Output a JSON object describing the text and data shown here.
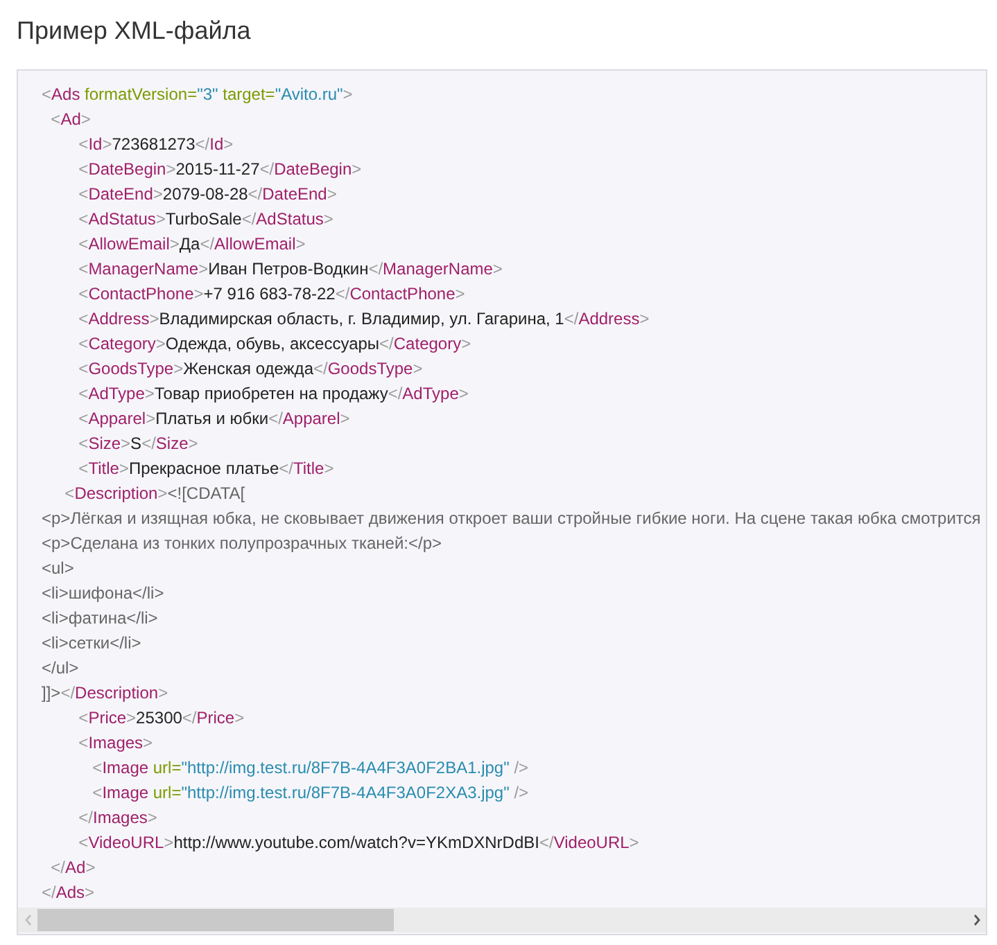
{
  "heading": "Пример XML-файла",
  "code_lines": [
    {
      "tokens": [
        {
          "kind": "punct",
          "text": "<"
        },
        {
          "kind": "tag",
          "text": "Ads"
        },
        {
          "kind": "attr",
          "text": " formatVersion="
        },
        {
          "kind": "value",
          "text": "\"3\""
        },
        {
          "kind": "attr",
          "text": " target="
        },
        {
          "kind": "value",
          "text": "\"Avito.ru\""
        },
        {
          "kind": "punct",
          "text": ">"
        }
      ]
    },
    {
      "tokens": [
        {
          "kind": "punct",
          "text": "  <"
        },
        {
          "kind": "tag",
          "text": "Ad"
        },
        {
          "kind": "punct",
          "text": ">"
        }
      ]
    },
    {
      "tokens": [
        {
          "kind": "punct",
          "text": "        <"
        },
        {
          "kind": "tag",
          "text": "Id"
        },
        {
          "kind": "punct",
          "text": ">"
        },
        {
          "kind": "text",
          "text": "723681273"
        },
        {
          "kind": "punct",
          "text": "</"
        },
        {
          "kind": "tag",
          "text": "Id"
        },
        {
          "kind": "punct",
          "text": ">"
        }
      ]
    },
    {
      "tokens": [
        {
          "kind": "punct",
          "text": "        <"
        },
        {
          "kind": "tag",
          "text": "DateBegin"
        },
        {
          "kind": "punct",
          "text": ">"
        },
        {
          "kind": "text",
          "text": "2015-11-27"
        },
        {
          "kind": "punct",
          "text": "</"
        },
        {
          "kind": "tag",
          "text": "DateBegin"
        },
        {
          "kind": "punct",
          "text": ">"
        }
      ]
    },
    {
      "tokens": [
        {
          "kind": "punct",
          "text": "        <"
        },
        {
          "kind": "tag",
          "text": "DateEnd"
        },
        {
          "kind": "punct",
          "text": ">"
        },
        {
          "kind": "text",
          "text": "2079-08-28"
        },
        {
          "kind": "punct",
          "text": "</"
        },
        {
          "kind": "tag",
          "text": "DateEnd"
        },
        {
          "kind": "punct",
          "text": ">"
        }
      ]
    },
    {
      "tokens": [
        {
          "kind": "punct",
          "text": "        <"
        },
        {
          "kind": "tag",
          "text": "AdStatus"
        },
        {
          "kind": "punct",
          "text": ">"
        },
        {
          "kind": "text",
          "text": "TurboSale"
        },
        {
          "kind": "punct",
          "text": "</"
        },
        {
          "kind": "tag",
          "text": "AdStatus"
        },
        {
          "kind": "punct",
          "text": ">"
        }
      ]
    },
    {
      "tokens": [
        {
          "kind": "punct",
          "text": "        <"
        },
        {
          "kind": "tag",
          "text": "AllowEmail"
        },
        {
          "kind": "punct",
          "text": ">"
        },
        {
          "kind": "text",
          "text": "Да"
        },
        {
          "kind": "punct",
          "text": "</"
        },
        {
          "kind": "tag",
          "text": "AllowEmail"
        },
        {
          "kind": "punct",
          "text": ">"
        }
      ]
    },
    {
      "tokens": [
        {
          "kind": "punct",
          "text": "        <"
        },
        {
          "kind": "tag",
          "text": "ManagerName"
        },
        {
          "kind": "punct",
          "text": ">"
        },
        {
          "kind": "text",
          "text": "Иван Петров-Водкин"
        },
        {
          "kind": "punct",
          "text": "</"
        },
        {
          "kind": "tag",
          "text": "ManagerName"
        },
        {
          "kind": "punct",
          "text": ">"
        }
      ]
    },
    {
      "tokens": [
        {
          "kind": "punct",
          "text": "        <"
        },
        {
          "kind": "tag",
          "text": "ContactPhone"
        },
        {
          "kind": "punct",
          "text": ">"
        },
        {
          "kind": "text",
          "text": "+7 916 683-78-22"
        },
        {
          "kind": "punct",
          "text": "</"
        },
        {
          "kind": "tag",
          "text": "ContactPhone"
        },
        {
          "kind": "punct",
          "text": ">"
        }
      ]
    },
    {
      "tokens": [
        {
          "kind": "punct",
          "text": "        <"
        },
        {
          "kind": "tag",
          "text": "Address"
        },
        {
          "kind": "punct",
          "text": ">"
        },
        {
          "kind": "text",
          "text": "Владимирская область, г. Владимир, ул. Гагарина, 1"
        },
        {
          "kind": "punct",
          "text": "</"
        },
        {
          "kind": "tag",
          "text": "Address"
        },
        {
          "kind": "punct",
          "text": ">"
        }
      ]
    },
    {
      "tokens": [
        {
          "kind": "punct",
          "text": "        <"
        },
        {
          "kind": "tag",
          "text": "Category"
        },
        {
          "kind": "punct",
          "text": ">"
        },
        {
          "kind": "text",
          "text": "Одежда, обувь, аксессуары"
        },
        {
          "kind": "punct",
          "text": "</"
        },
        {
          "kind": "tag",
          "text": "Category"
        },
        {
          "kind": "punct",
          "text": ">"
        }
      ]
    },
    {
      "tokens": [
        {
          "kind": "punct",
          "text": "        <"
        },
        {
          "kind": "tag",
          "text": "GoodsType"
        },
        {
          "kind": "punct",
          "text": ">"
        },
        {
          "kind": "text",
          "text": "Женская одежда"
        },
        {
          "kind": "punct",
          "text": "</"
        },
        {
          "kind": "tag",
          "text": "GoodsType"
        },
        {
          "kind": "punct",
          "text": ">"
        }
      ]
    },
    {
      "tokens": [
        {
          "kind": "punct",
          "text": "        <"
        },
        {
          "kind": "tag",
          "text": "AdType"
        },
        {
          "kind": "punct",
          "text": ">"
        },
        {
          "kind": "text",
          "text": "Товар приобретен на продажу"
        },
        {
          "kind": "punct",
          "text": "</"
        },
        {
          "kind": "tag",
          "text": "AdType"
        },
        {
          "kind": "punct",
          "text": ">"
        }
      ]
    },
    {
      "tokens": [
        {
          "kind": "punct",
          "text": "        <"
        },
        {
          "kind": "tag",
          "text": "Apparel"
        },
        {
          "kind": "punct",
          "text": ">"
        },
        {
          "kind": "text",
          "text": "Платья и юбки"
        },
        {
          "kind": "punct",
          "text": "</"
        },
        {
          "kind": "tag",
          "text": "Apparel"
        },
        {
          "kind": "punct",
          "text": ">"
        }
      ]
    },
    {
      "tokens": [
        {
          "kind": "punct",
          "text": "        <"
        },
        {
          "kind": "tag",
          "text": "Size"
        },
        {
          "kind": "punct",
          "text": ">"
        },
        {
          "kind": "text",
          "text": "S"
        },
        {
          "kind": "punct",
          "text": "</"
        },
        {
          "kind": "tag",
          "text": "Size"
        },
        {
          "kind": "punct",
          "text": ">"
        }
      ]
    },
    {
      "tokens": [
        {
          "kind": "punct",
          "text": "        <"
        },
        {
          "kind": "tag",
          "text": "Title"
        },
        {
          "kind": "punct",
          "text": ">"
        },
        {
          "kind": "text",
          "text": "Прекрасное платье"
        },
        {
          "kind": "punct",
          "text": "</"
        },
        {
          "kind": "tag",
          "text": "Title"
        },
        {
          "kind": "punct",
          "text": ">"
        }
      ]
    },
    {
      "tokens": [
        {
          "kind": "punct",
          "text": "     <"
        },
        {
          "kind": "tag",
          "text": "Description"
        },
        {
          "kind": "punct",
          "text": ">"
        },
        {
          "kind": "markup",
          "text": "<![CDATA["
        }
      ]
    },
    {
      "tokens": [
        {
          "kind": "markup",
          "text": "<p>Лёгкая и изящная юбка, не сковывает движения откроет ваши стройные гибкие ноги. На сцене такая юбка смотрится"
        }
      ]
    },
    {
      "tokens": [
        {
          "kind": "markup",
          "text": "<p>Сделана из тонких полупрозрачных тканей:</p>"
        }
      ]
    },
    {
      "tokens": [
        {
          "kind": "markup",
          "text": "<ul>"
        }
      ]
    },
    {
      "tokens": [
        {
          "kind": "markup",
          "text": "<li>шифона</li>"
        }
      ]
    },
    {
      "tokens": [
        {
          "kind": "markup",
          "text": "<li>фатина</li>"
        }
      ]
    },
    {
      "tokens": [
        {
          "kind": "markup",
          "text": "<li>сетки</li>"
        }
      ]
    },
    {
      "tokens": [
        {
          "kind": "markup",
          "text": "</ul>"
        }
      ]
    },
    {
      "tokens": [
        {
          "kind": "markup",
          "text": "]]>"
        },
        {
          "kind": "punct",
          "text": "</"
        },
        {
          "kind": "tag",
          "text": "Description"
        },
        {
          "kind": "punct",
          "text": ">"
        }
      ]
    },
    {
      "tokens": [
        {
          "kind": "punct",
          "text": "        <"
        },
        {
          "kind": "tag",
          "text": "Price"
        },
        {
          "kind": "punct",
          "text": ">"
        },
        {
          "kind": "text",
          "text": "25300"
        },
        {
          "kind": "punct",
          "text": "</"
        },
        {
          "kind": "tag",
          "text": "Price"
        },
        {
          "kind": "punct",
          "text": ">"
        }
      ]
    },
    {
      "tokens": [
        {
          "kind": "punct",
          "text": "        <"
        },
        {
          "kind": "tag",
          "text": "Images"
        },
        {
          "kind": "punct",
          "text": ">"
        }
      ]
    },
    {
      "tokens": [
        {
          "kind": "punct",
          "text": "           <"
        },
        {
          "kind": "tag",
          "text": "Image"
        },
        {
          "kind": "attr",
          "text": " url="
        },
        {
          "kind": "value",
          "text": "\"http://img.test.ru/8F7B-4A4F3A0F2BA1.jpg\""
        },
        {
          "kind": "punct",
          "text": " />"
        }
      ]
    },
    {
      "tokens": [
        {
          "kind": "punct",
          "text": "           <"
        },
        {
          "kind": "tag",
          "text": "Image"
        },
        {
          "kind": "attr",
          "text": " url="
        },
        {
          "kind": "value",
          "text": "\"http://img.test.ru/8F7B-4A4F3A0F2XA3.jpg\""
        },
        {
          "kind": "punct",
          "text": " />"
        }
      ]
    },
    {
      "tokens": [
        {
          "kind": "punct",
          "text": "        </"
        },
        {
          "kind": "tag",
          "text": "Images"
        },
        {
          "kind": "punct",
          "text": ">"
        }
      ]
    },
    {
      "tokens": [
        {
          "kind": "punct",
          "text": "        <"
        },
        {
          "kind": "tag",
          "text": "VideoURL"
        },
        {
          "kind": "punct",
          "text": ">"
        },
        {
          "kind": "text",
          "text": "http://www.youtube.com/watch?v=YKmDXNrDdBI"
        },
        {
          "kind": "punct",
          "text": "</"
        },
        {
          "kind": "tag",
          "text": "VideoURL"
        },
        {
          "kind": "punct",
          "text": ">"
        }
      ]
    },
    {
      "tokens": [
        {
          "kind": "punct",
          "text": "  </"
        },
        {
          "kind": "tag",
          "text": "Ad"
        },
        {
          "kind": "punct",
          "text": ">"
        }
      ]
    },
    {
      "tokens": [
        {
          "kind": "punct",
          "text": "</"
        },
        {
          "kind": "tag",
          "text": "Ads"
        },
        {
          "kind": "punct",
          "text": ">"
        }
      ]
    }
  ]
}
